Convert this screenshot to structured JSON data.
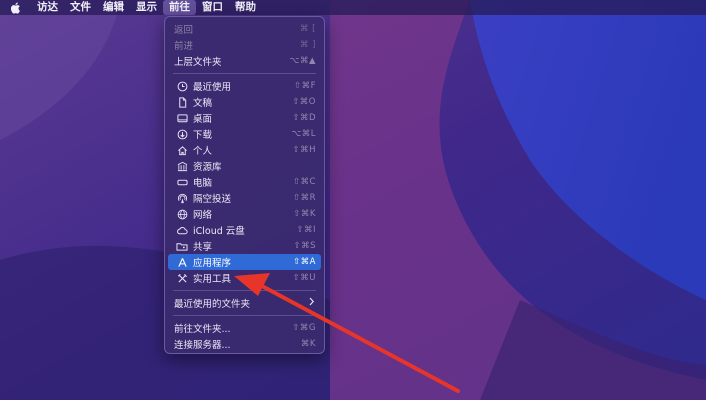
{
  "menubar": {
    "apple_icon": "apple-logo-icon",
    "items": [
      "访达",
      "文件",
      "编辑",
      "显示",
      "前往",
      "窗口",
      "帮助"
    ],
    "active_index": 4
  },
  "go_menu": {
    "back": {
      "label": "返回",
      "shortcut": "⌘ ["
    },
    "forward": {
      "label": "前进",
      "shortcut": "⌘ ]"
    },
    "enclosing": {
      "label": "上层文件夹",
      "shortcut": "⌥⌘▲"
    },
    "items": [
      {
        "label": "最近使用",
        "shortcut": "⇧⌘F",
        "icon": "clock-icon"
      },
      {
        "label": "文稿",
        "shortcut": "⇧⌘O",
        "icon": "document-icon"
      },
      {
        "label": "桌面",
        "shortcut": "⇧⌘D",
        "icon": "desktop-icon"
      },
      {
        "label": "下载",
        "shortcut": "⌥⌘L",
        "icon": "download-icon"
      },
      {
        "label": "个人",
        "shortcut": "⇧⌘H",
        "icon": "home-icon"
      },
      {
        "label": "资源库",
        "shortcut": "",
        "icon": "library-icon"
      },
      {
        "label": "电脑",
        "shortcut": "⇧⌘C",
        "icon": "computer-icon"
      },
      {
        "label": "隔空投送",
        "shortcut": "⇧⌘R",
        "icon": "airdrop-icon"
      },
      {
        "label": "网络",
        "shortcut": "⇧⌘K",
        "icon": "network-icon"
      },
      {
        "label": "iCloud 云盘",
        "shortcut": "⇧⌘I",
        "icon": "icloud-icon"
      },
      {
        "label": "共享",
        "shortcut": "⇧⌘S",
        "icon": "shared-folder-icon"
      },
      {
        "label": "应用程序",
        "shortcut": "⇧⌘A",
        "icon": "applications-icon"
      },
      {
        "label": "实用工具",
        "shortcut": "⇧⌘U",
        "icon": "utilities-icon"
      }
    ],
    "recent_folders": {
      "label": "最近使用的文件夹"
    },
    "goto_folder": {
      "label": "前往文件夹...",
      "shortcut": "⇧⌘G"
    },
    "connect_server": {
      "label": "连接服务器...",
      "shortcut": "⌘K"
    }
  },
  "colors": {
    "selection": "#2f6ad6",
    "annotation_arrow": "#e8352a"
  }
}
